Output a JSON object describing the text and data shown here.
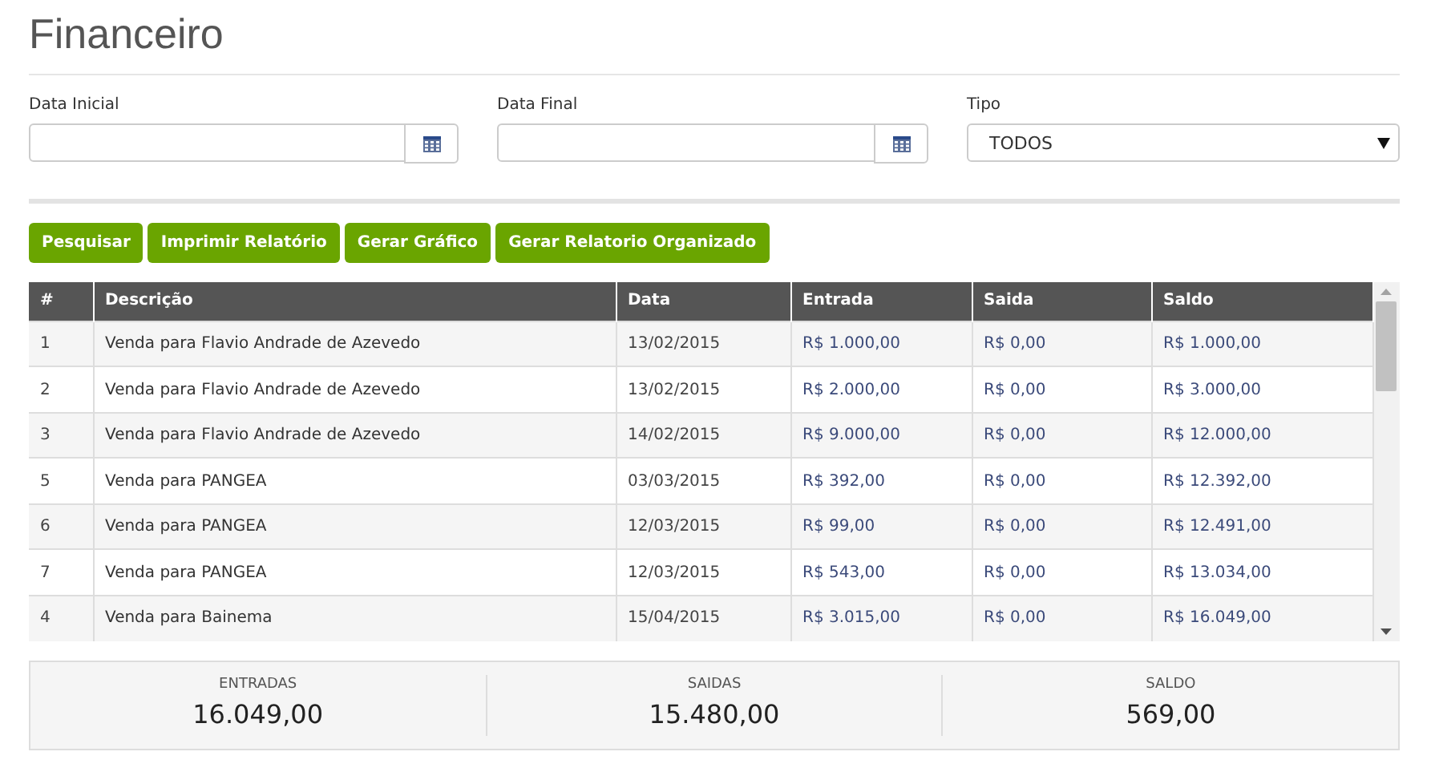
{
  "title": "Financeiro",
  "filters": [
    {
      "kind": "date",
      "label": "Data Inicial"
    },
    {
      "kind": "date",
      "label": "Data Final"
    },
    {
      "kind": "select",
      "label": "Tipo",
      "value": "TODOS"
    }
  ],
  "buttons": [
    "Pesquisar",
    "Imprimir Relatório",
    "Gerar Gráfico",
    "Gerar Relatorio Organizado"
  ],
  "table": {
    "columns": [
      "#",
      "Descrição",
      "Data",
      "Entrada",
      "Saida",
      "Saldo"
    ],
    "rows": [
      [
        "1",
        "Venda para Flavio Andrade de Azevedo",
        "13/02/2015",
        "R$ 1.000,00",
        "R$ 0,00",
        "R$ 1.000,00"
      ],
      [
        "2",
        "Venda para Flavio Andrade de Azevedo",
        "13/02/2015",
        "R$ 2.000,00",
        "R$ 0,00",
        "R$ 3.000,00"
      ],
      [
        "3",
        "Venda para Flavio Andrade de Azevedo",
        "14/02/2015",
        "R$ 9.000,00",
        "R$ 0,00",
        "R$ 12.000,00"
      ],
      [
        "5",
        "Venda para PANGEA",
        "03/03/2015",
        "R$ 392,00",
        "R$ 0,00",
        "R$ 12.392,00"
      ],
      [
        "6",
        "Venda para PANGEA",
        "12/03/2015",
        "R$ 99,00",
        "R$ 0,00",
        "R$ 12.491,00"
      ],
      [
        "7",
        "Venda para PANGEA",
        "12/03/2015",
        "R$ 543,00",
        "R$ 0,00",
        "R$ 13.034,00"
      ],
      [
        "4",
        "Venda para Bainema",
        "15/04/2015",
        "R$ 3.015,00",
        "R$ 0,00",
        "R$ 16.049,00"
      ]
    ]
  },
  "summary": [
    {
      "label": "ENTRADAS",
      "value": "16.049,00"
    },
    {
      "label": "SAIDAS",
      "value": "15.480,00"
    },
    {
      "label": "SALDO",
      "value": "569,00"
    }
  ]
}
